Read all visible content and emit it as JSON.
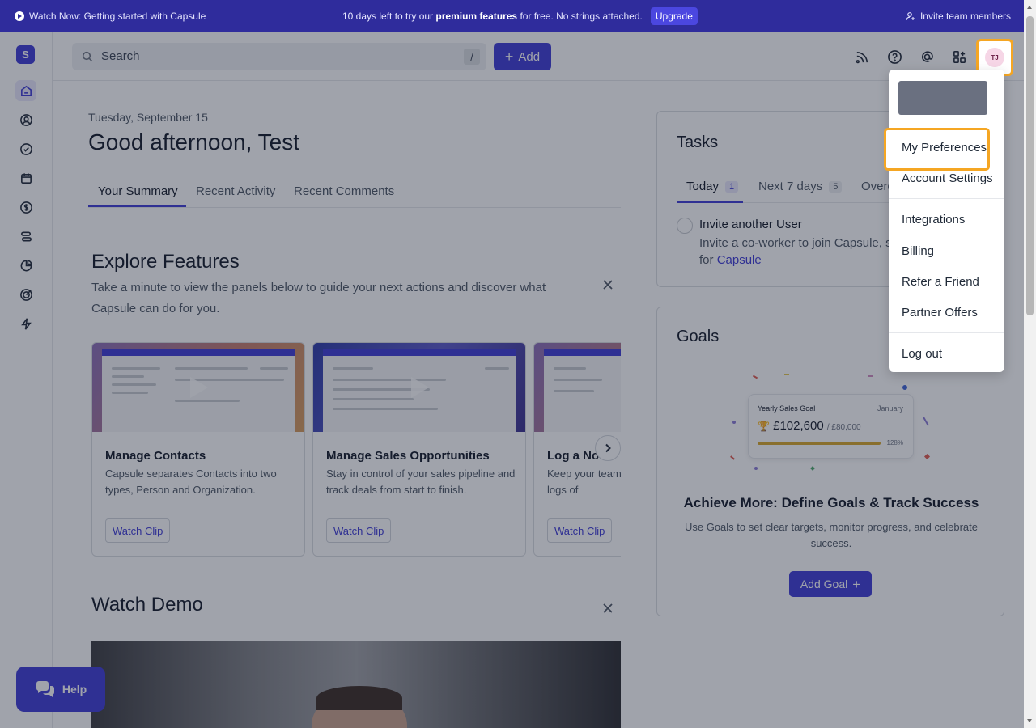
{
  "banner": {
    "watch_text": "Watch Now: Getting started with Capsule",
    "promo_prefix": "10 days left to try our",
    "promo_bold": "premium features",
    "promo_suffix": "for free. No strings attached.",
    "upgrade_label": "Upgrade",
    "invite_label": "Invite team members"
  },
  "rail": {
    "logo_letter": "S",
    "items": [
      "home-icon",
      "contacts-icon",
      "tasks-icon",
      "calendar-icon",
      "sales-icon",
      "projects-icon",
      "reports-icon",
      "goals-icon",
      "workflow-icon"
    ]
  },
  "header": {
    "search_placeholder": "Search",
    "search_shortcut": "/",
    "add_label": "Add",
    "avatar_initials": "TJ"
  },
  "main": {
    "date": "Tuesday, September 15",
    "greeting": "Good afternoon, Test",
    "tabs": [
      "Your Summary",
      "Recent Activity",
      "Recent Comments"
    ],
    "explore": {
      "title": "Explore Features",
      "description": "Take a minute to view the panels below to guide your next actions and discover what Capsule can do for you.",
      "cards": [
        {
          "title": "Manage Contacts",
          "description": "Capsule separates Contacts into two types, Person and Organization.",
          "button": "Watch Clip"
        },
        {
          "title": "Manage Sales Opportunities",
          "description": "Stay in control of your sales pipeline and track deals from start to finish.",
          "button": "Watch Clip"
        },
        {
          "title": "Log a Note",
          "description": "Keep your team up to date with detailed logs of",
          "button": "Watch Clip"
        }
      ]
    },
    "demo": {
      "title": "Watch Demo"
    }
  },
  "tasks": {
    "title": "Tasks",
    "tabs": [
      {
        "label": "Today",
        "count": "1"
      },
      {
        "label": "Next 7 days",
        "count": "5"
      },
      {
        "label": "Overdue"
      }
    ],
    "item": {
      "title": "Invite another User",
      "description_prefix": "Invite a co-worker to join Capsule, so",
      "description_suffix": "for",
      "link": "Capsule"
    }
  },
  "goals": {
    "title": "Goals",
    "illustration": {
      "goal_name": "Yearly Sales Goal",
      "month": "January",
      "value": "£102,600",
      "target": "/ £80,000",
      "percent": "128%"
    },
    "headline": "Achieve More: Define Goals & Track Success",
    "description": "Use Goals to set clear targets, monitor progress, and celebrate success.",
    "add_label": "Add Goal"
  },
  "help": {
    "label": "Help"
  },
  "dropdown": {
    "items": [
      {
        "label": "My Preferences"
      },
      {
        "label": "Account Settings"
      },
      {
        "label": "Integrations"
      },
      {
        "label": "Billing"
      },
      {
        "label": "Refer a Friend"
      },
      {
        "label": "Partner Offers"
      },
      {
        "label": "Log out"
      }
    ]
  },
  "colors": {
    "brand": "#3d39d6",
    "banner_bg": "#2f2c9c",
    "highlight": "#f5a623"
  }
}
